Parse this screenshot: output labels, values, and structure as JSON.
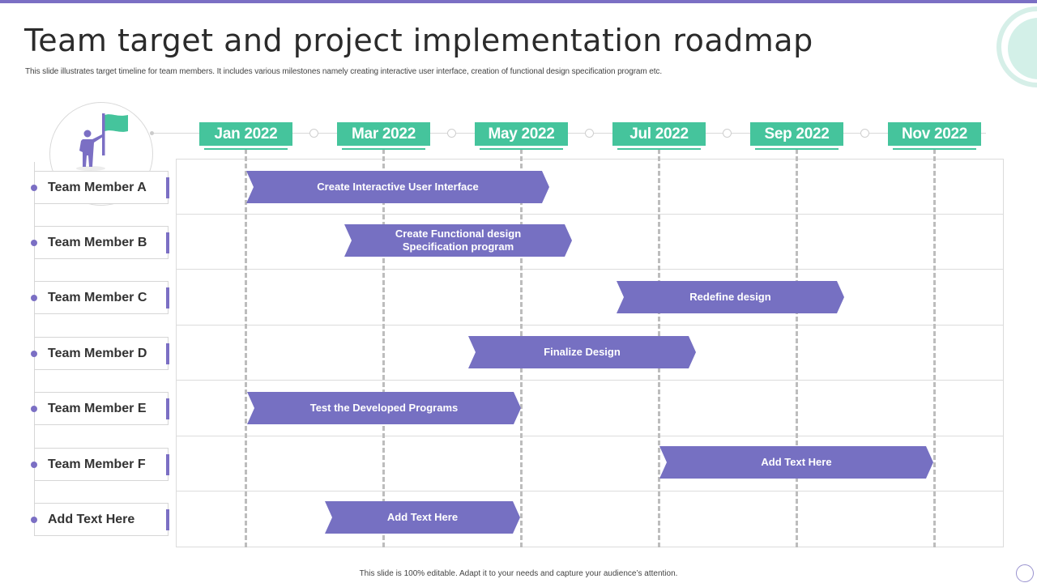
{
  "slide": {
    "title": "Team target and project implementation roadmap",
    "subtitle": "This slide illustrates target timeline  for team members. It includes various milestones namely  creating interactive user interface, creation of functional design specification program etc.",
    "footer": "This slide is 100% editable.  Adapt it to your needs and capture your audience’s attention."
  },
  "colors": {
    "accent_purple": "#7B6FC4",
    "bar_purple": "#7670C2",
    "month_teal": "#45C49C",
    "decor_mint": "#D3F0E8"
  },
  "icons": {
    "hero": "person-with-flag-icon",
    "corner": "circle-outline-icon"
  },
  "timeline": {
    "months": [
      "Jan 2022",
      "Mar 2022",
      "May 2022",
      "Jul 2022",
      "Sep 2022",
      "Nov 2022"
    ]
  },
  "members": [
    "Team Member A",
    "Team Member B",
    "Team Member C",
    "Team Member D",
    "Team Member E",
    "Team Member F",
    "Add Text Here"
  ],
  "tasks": [
    {
      "row": 0,
      "label": "Create Interactive User Interface",
      "start": "Jan 2022",
      "end": "mid May 2022"
    },
    {
      "row": 1,
      "label": "Create Functional design\nSpecification program",
      "start": "early Mar 2022",
      "end": "early Jun 2022"
    },
    {
      "row": 2,
      "label": "Redefine design",
      "start": "mid Jun 2022",
      "end": "end Sep 2022"
    },
    {
      "row": 3,
      "label": "Finalize Design",
      "start": "May 2022",
      "end": "early Aug 2022"
    },
    {
      "row": 4,
      "label": "Test the Developed Programs",
      "start": "Jan 2022",
      "end": "May 2022"
    },
    {
      "row": 5,
      "label": "Add Text Here",
      "start": "Jul 2022",
      "end": "Nov 2022"
    },
    {
      "row": 6,
      "label": "Add Text Here",
      "start": "late Feb 2022",
      "end": "May 2022"
    }
  ]
}
